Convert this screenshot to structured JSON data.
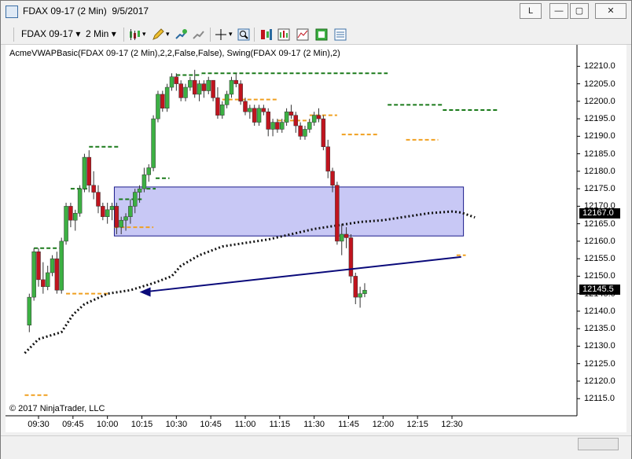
{
  "window": {
    "title": "FDAX 09-17 (2 Min)  9/5/2017",
    "btn_layout": "L",
    "btn_min": "—",
    "btn_max": "▢",
    "btn_close": "✕"
  },
  "toolbar": {
    "instrument": "FDAX 09-17",
    "interval": "2 Min"
  },
  "chart": {
    "indicator_label": "AcmeVWAPBasic(FDAX 09-17 (2 Min),2,2,False,False), Swing(FDAX 09-17 (2 Min),2)",
    "copyright": "© 2017 NinjaTrader, LLC",
    "last_price": "12145.5",
    "vwap_price": "12167.0",
    "y_ticks": [
      "12210.0",
      "12205.0",
      "12200.0",
      "12195.0",
      "12190.0",
      "12185.0",
      "12180.0",
      "12175.0",
      "12170.0",
      "12165.0",
      "12160.0",
      "12155.0",
      "12150.0",
      "12145.0",
      "12140.0",
      "12135.0",
      "12130.0",
      "12125.0",
      "12120.0",
      "12115.0"
    ],
    "x_ticks": [
      "09:30",
      "09:45",
      "10:00",
      "10:15",
      "10:30",
      "10:45",
      "11:00",
      "11:15",
      "11:30",
      "11:45",
      "12:00",
      "12:15",
      "12:30"
    ],
    "colors": {
      "up": "#3cb043",
      "down": "#c0141e",
      "swing_high": "#1a7a1a",
      "swing_low": "#f0a020",
      "zone_fill": "#c8c8f5",
      "zone_border": "#1a1a8a",
      "arrow": "#0a0a7a",
      "vwap": "#111111"
    }
  },
  "chart_data": {
    "type": "candlestick",
    "title": "",
    "ylim": [
      12111,
      12213
    ],
    "x_start": "09:26",
    "bar_minutes": 2,
    "ohlc": [
      [
        12136,
        12145,
        12134,
        12144
      ],
      [
        12144,
        12158,
        12143,
        12157
      ],
      [
        12157,
        12158,
        12147,
        12149
      ],
      [
        12149,
        12154,
        12145,
        12147
      ],
      [
        12147,
        12153,
        12146,
        12151
      ],
      [
        12151,
        12156,
        12150,
        12155
      ],
      [
        12155,
        12157,
        12145,
        12146
      ],
      [
        12146,
        12161,
        12145,
        12160
      ],
      [
        12160,
        12171,
        12159,
        12170
      ],
      [
        12170,
        12171,
        12164,
        12166
      ],
      [
        12166,
        12169,
        12163,
        12168
      ],
      [
        12168,
        12176,
        12167,
        12175
      ],
      [
        12175,
        12185,
        12174,
        12184
      ],
      [
        12184,
        12186,
        12174,
        12176
      ],
      [
        12176,
        12180,
        12172,
        12174
      ],
      [
        12174,
        12176,
        12168,
        12170
      ],
      [
        12170,
        12171,
        12166,
        12167
      ],
      [
        12167,
        12171,
        12165,
        12169
      ],
      [
        12169,
        12171,
        12166,
        12170
      ],
      [
        12170,
        12171,
        12162,
        12164
      ],
      [
        12164,
        12167,
        12162,
        12166
      ],
      [
        12166,
        12168,
        12163,
        12167
      ],
      [
        12167,
        12172,
        12165,
        12170
      ],
      [
        12170,
        12175,
        12168,
        12174
      ],
      [
        12174,
        12176,
        12171,
        12175
      ],
      [
        12175,
        12181,
        12174,
        12179
      ],
      [
        12179,
        12182,
        12177,
        12181
      ],
      [
        12181,
        12196,
        12180,
        12195
      ],
      [
        12195,
        12203,
        12194,
        12202
      ],
      [
        12202,
        12203,
        12197,
        12198
      ],
      [
        12198,
        12205,
        12197,
        12204
      ],
      [
        12204,
        12208,
        12203,
        12207
      ],
      [
        12207,
        12208,
        12203,
        12205
      ],
      [
        12205,
        12206,
        12200,
        12201
      ],
      [
        12201,
        12205,
        12200,
        12204
      ],
      [
        12204,
        12207,
        12203,
        12206
      ],
      [
        12206,
        12209,
        12201,
        12202
      ],
      [
        12202,
        12206,
        12200,
        12205
      ],
      [
        12205,
        12206,
        12201,
        12203
      ],
      [
        12203,
        12207,
        12202,
        12206
      ],
      [
        12206,
        12206,
        12200,
        12201
      ],
      [
        12201,
        12204,
        12195,
        12196
      ],
      [
        12196,
        12200,
        12195,
        12199
      ],
      [
        12199,
        12203,
        12198,
        12202
      ],
      [
        12202,
        12207,
        12201,
        12206
      ],
      [
        12206,
        12208,
        12204,
        12205
      ],
      [
        12205,
        12206,
        12199,
        12200
      ],
      [
        12200,
        12201,
        12196,
        12197
      ],
      [
        12197,
        12199,
        12195,
        12198
      ],
      [
        12198,
        12199,
        12193,
        12194
      ],
      [
        12194,
        12199,
        12193,
        12198
      ],
      [
        12198,
        12199,
        12196,
        12197
      ],
      [
        12197,
        12198,
        12190,
        12192
      ],
      [
        12192,
        12195,
        12190,
        12194
      ],
      [
        12194,
        12195,
        12191,
        12192
      ],
      [
        12192,
        12195,
        12191,
        12194
      ],
      [
        12194,
        12198,
        12193,
        12197
      ],
      [
        12197,
        12199,
        12195,
        12196
      ],
      [
        12196,
        12197,
        12191,
        12193
      ],
      [
        12193,
        12194,
        12189,
        12190
      ],
      [
        12190,
        12193,
        12189,
        12192
      ],
      [
        12192,
        12195,
        12191,
        12194
      ],
      [
        12194,
        12197,
        12193,
        12196
      ],
      [
        12196,
        12198,
        12194,
        12195
      ],
      [
        12195,
        12196,
        12186,
        12187
      ],
      [
        12187,
        12189,
        12178,
        12180
      ],
      [
        12180,
        12181,
        12174,
        12176
      ],
      [
        12176,
        12177,
        12159,
        12160
      ],
      [
        12160,
        12165,
        12156,
        12162
      ],
      [
        12162,
        12164,
        12158,
        12161
      ],
      [
        12161,
        12162,
        12148,
        12150
      ],
      [
        12150,
        12151,
        12142,
        12144
      ],
      [
        12144,
        12147,
        12141,
        12145
      ],
      [
        12145,
        12148,
        12144,
        12146
      ]
    ],
    "zone": {
      "x_from": "10:03",
      "x_to": "12:35",
      "y_low": 12161.5,
      "y_high": 12175.5
    },
    "arrow": {
      "from": [
        "12:34",
        12155.5
      ],
      "to": [
        "10:14",
        12145.5
      ]
    },
    "swing_highs": [
      [
        "09:28",
        "09:39",
        12158
      ],
      [
        "09:44",
        "09:52",
        12175
      ],
      [
        "09:52",
        "10:05",
        12187
      ],
      [
        "10:05",
        "10:15",
        12172
      ],
      [
        "10:17",
        "10:21",
        12175
      ],
      [
        "10:21",
        "10:27",
        12178
      ],
      [
        "10:30",
        "10:41",
        12207.5
      ],
      [
        "10:41",
        "12:02",
        12208
      ],
      [
        "12:02",
        "12:26",
        12199
      ],
      [
        "12:26",
        "12:50",
        12197.5
      ]
    ],
    "swing_lows": [
      [
        "09:24",
        "09:34",
        12116
      ],
      [
        "09:42",
        "10:01",
        12145
      ],
      [
        "10:03",
        "10:20",
        12164
      ],
      [
        "10:50",
        "11:14",
        12200.5
      ],
      [
        "11:14",
        "11:28",
        12194.5
      ],
      [
        "11:28",
        "11:40",
        12196
      ],
      [
        "11:42",
        "11:58",
        12190.5
      ],
      [
        "12:10",
        "12:24",
        12189
      ],
      [
        "12:32",
        "12:36",
        12156
      ]
    ],
    "vwap": [
      [
        "09:24",
        12128
      ],
      [
        "09:30",
        12132
      ],
      [
        "09:40",
        12134
      ],
      [
        "09:45",
        12139
      ],
      [
        "09:50",
        12142
      ],
      [
        "10:00",
        12145
      ],
      [
        "10:10",
        12146
      ],
      [
        "10:20",
        12148
      ],
      [
        "10:28",
        12150
      ],
      [
        "10:32",
        12153
      ],
      [
        "10:40",
        12156
      ],
      [
        "10:50",
        12158.5
      ],
      [
        "11:00",
        12159.5
      ],
      [
        "11:10",
        12160.5
      ],
      [
        "11:20",
        12162
      ],
      [
        "11:30",
        12163.5
      ],
      [
        "11:40",
        12164.5
      ],
      [
        "11:50",
        12165.5
      ],
      [
        "12:00",
        12166
      ],
      [
        "12:10",
        12167
      ],
      [
        "12:20",
        12168
      ],
      [
        "12:30",
        12168.5
      ],
      [
        "12:34",
        12168.2
      ],
      [
        "12:40",
        12166.8
      ]
    ]
  }
}
